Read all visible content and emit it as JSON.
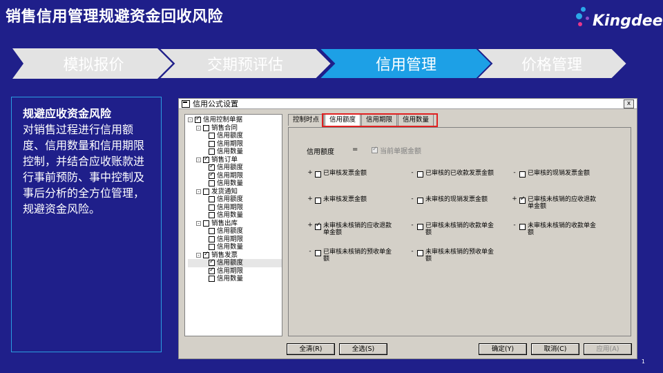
{
  "slide": {
    "title": "销售信用管理规避资金回收风险",
    "page_number": "1"
  },
  "logo": {
    "text": "Kingdee",
    "colors": [
      "#2ba7e8",
      "#e8378a",
      "#8f4fc7"
    ]
  },
  "steps": [
    {
      "label": "模拟报价",
      "active": false
    },
    {
      "label": "交期预评估",
      "active": false
    },
    {
      "label": "信用管理",
      "active": true
    },
    {
      "label": "价格管理",
      "active": false
    }
  ],
  "left_panel": {
    "heading": "规避应收资金风险",
    "body": "对销售过程进行信用额度、信用数量和信用期限控制，并结合应收账款进行事前预防、事中控制及事后分析的全方位管理，规避资金风险。"
  },
  "window": {
    "title": "信用公式设置",
    "close": "x",
    "tree": [
      {
        "label": "信用控制单据",
        "level": 0,
        "checked": true,
        "expander": "-"
      },
      {
        "label": "销售合同",
        "level": 1,
        "checked": false,
        "expander": "-"
      },
      {
        "label": "信用额度",
        "level": 2,
        "checked": false
      },
      {
        "label": "信用期限",
        "level": 2,
        "checked": false
      },
      {
        "label": "信用数量",
        "level": 2,
        "checked": false
      },
      {
        "label": "销售订单",
        "level": 1,
        "checked": true,
        "expander": "-"
      },
      {
        "label": "信用额度",
        "level": 2,
        "checked": true
      },
      {
        "label": "信用期限",
        "level": 2,
        "checked": true
      },
      {
        "label": "信用数量",
        "level": 2,
        "checked": false
      },
      {
        "label": "发货通知",
        "level": 1,
        "checked": false,
        "expander": "-"
      },
      {
        "label": "信用额度",
        "level": 2,
        "checked": false
      },
      {
        "label": "信用期限",
        "level": 2,
        "checked": false
      },
      {
        "label": "信用数量",
        "level": 2,
        "checked": false
      },
      {
        "label": "销售出库",
        "level": 1,
        "checked": false,
        "expander": "-"
      },
      {
        "label": "信用额度",
        "level": 2,
        "checked": false
      },
      {
        "label": "信用期限",
        "level": 2,
        "checked": false
      },
      {
        "label": "信用数量",
        "level": 2,
        "checked": false
      },
      {
        "label": "销售发票",
        "level": 1,
        "checked": true,
        "expander": "-"
      },
      {
        "label": "信用额度",
        "level": 2,
        "checked": true,
        "highlight": true
      },
      {
        "label": "信用期限",
        "level": 2,
        "checked": true
      },
      {
        "label": "信用数量",
        "level": 2,
        "checked": false
      }
    ],
    "tabs": [
      {
        "label": "控制时点",
        "active": false
      },
      {
        "label": "信用额度",
        "active": true
      },
      {
        "label": "信用期限",
        "active": false
      },
      {
        "label": "信用数量",
        "active": false
      }
    ],
    "formula": {
      "label": "信用额度",
      "equals": "=",
      "current_amount": {
        "label": "当前单据金额",
        "checked": true
      }
    },
    "items": [
      {
        "op": "+",
        "label": "已审核发票金额",
        "checked": false
      },
      {
        "op": "-",
        "label": "已审核的已收款发票金额",
        "checked": false
      },
      {
        "op": "-",
        "label": "已审核的现销发票金额",
        "checked": false
      },
      {
        "op": "+",
        "label": "未审核发票金额",
        "checked": false
      },
      {
        "op": "-",
        "label": "未审核的现销发票金额",
        "checked": false
      },
      {
        "op": "+",
        "label": "已审核未核销的应收退款单金额",
        "checked": true
      },
      {
        "op": "+",
        "label": "未审核未核销的应收退款单金额",
        "checked": true
      },
      {
        "op": "-",
        "label": "已审核未核销的收款单金额",
        "checked": false
      },
      {
        "op": "-",
        "label": "未审核未核销的收款单金额",
        "checked": false
      },
      {
        "op": "-",
        "label": "已审核未核销的预收单金额",
        "checked": false
      },
      {
        "op": "-",
        "label": "未审核未核销的预收单金额",
        "checked": false
      }
    ],
    "buttons": {
      "clear": "全清(R)",
      "select_all": "全选(S)",
      "ok": "确定(Y)",
      "cancel": "取消(C)",
      "apply": "应用(A)"
    }
  }
}
